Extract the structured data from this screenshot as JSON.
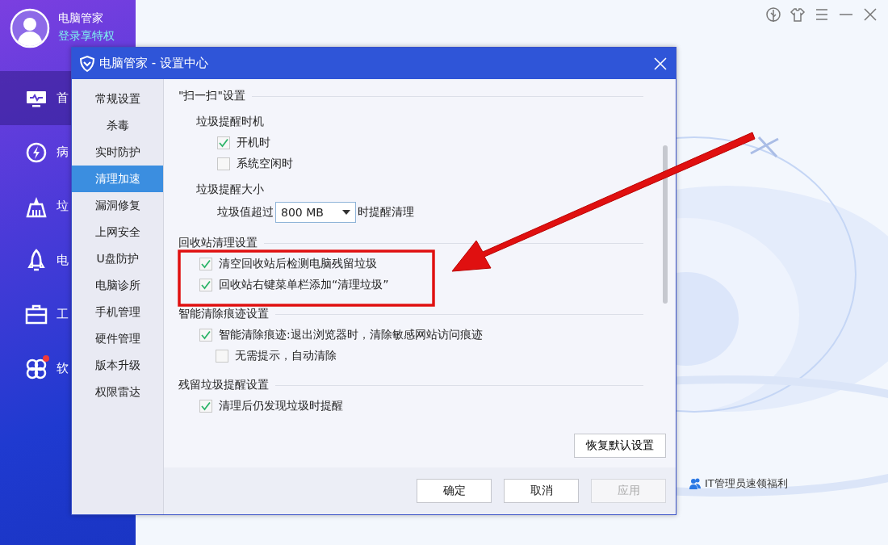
{
  "app": {
    "name": "电脑管家",
    "login_link": "登录享特权",
    "nav": [
      {
        "label": "首",
        "selected": true,
        "badge": false
      },
      {
        "label": "病",
        "selected": false,
        "badge": false
      },
      {
        "label": "垃",
        "selected": false,
        "badge": false
      },
      {
        "label": "电",
        "selected": false,
        "badge": false
      },
      {
        "label": "工",
        "selected": false,
        "badge": false
      },
      {
        "label": "软",
        "selected": false,
        "badge": true
      }
    ],
    "promo": "IT管理员速领福利"
  },
  "dialog": {
    "title": "电脑管家 - 设置中心",
    "categories": [
      {
        "label": "常规设置",
        "selected": false
      },
      {
        "label": "杀毒",
        "selected": false
      },
      {
        "label": "实时防护",
        "selected": false
      },
      {
        "label": "清理加速",
        "selected": true
      },
      {
        "label": "漏洞修复",
        "selected": false
      },
      {
        "label": "上网安全",
        "selected": false
      },
      {
        "label": "U盘防护",
        "selected": false
      },
      {
        "label": "电脑诊所",
        "selected": false
      },
      {
        "label": "手机管理",
        "selected": false
      },
      {
        "label": "硬件管理",
        "selected": false
      },
      {
        "label": "版本升级",
        "selected": false
      },
      {
        "label": "权限雷达",
        "selected": false
      }
    ],
    "sections": [
      {
        "title": "\"扫一扫\"设置",
        "items": [
          {
            "kind": "group",
            "label": "垃圾提醒时机",
            "children": [
              {
                "kind": "checkbox",
                "label": "开机时",
                "checked": true
              },
              {
                "kind": "checkbox",
                "label": "系统空闲时",
                "checked": false
              }
            ]
          },
          {
            "kind": "group",
            "label": "垃圾提醒大小",
            "children": [
              {
                "kind": "dropdown",
                "before": "垃圾值超过",
                "value": "800 MB",
                "after": "时提醒清理"
              }
            ]
          }
        ]
      },
      {
        "title": "回收站清理设置",
        "items": [
          {
            "kind": "checkbox",
            "label": "清空回收站后检测电脑残留垃圾",
            "checked": true
          },
          {
            "kind": "checkbox",
            "label": "回收站右键菜单栏添加“清理垃圾”",
            "checked": true
          }
        ]
      },
      {
        "title": "智能清除痕迹设置",
        "items": [
          {
            "kind": "checkbox",
            "label": "智能清除痕迹:退出浏览器时，清除敏感网站访问痕迹",
            "checked": true,
            "children": [
              {
                "kind": "checkbox",
                "label": "无需提示，自动清除",
                "checked": false
              }
            ]
          }
        ]
      },
      {
        "title": "残留垃圾提醒设置",
        "items": [
          {
            "kind": "checkbox",
            "label": "清理后仍发现垃圾时提醒",
            "checked": true
          }
        ]
      }
    ],
    "restore_button": "恢复默认设置",
    "buttons": [
      {
        "label": "确定",
        "disabled": false
      },
      {
        "label": "取消",
        "disabled": false
      },
      {
        "label": "应用",
        "disabled": true
      }
    ]
  }
}
